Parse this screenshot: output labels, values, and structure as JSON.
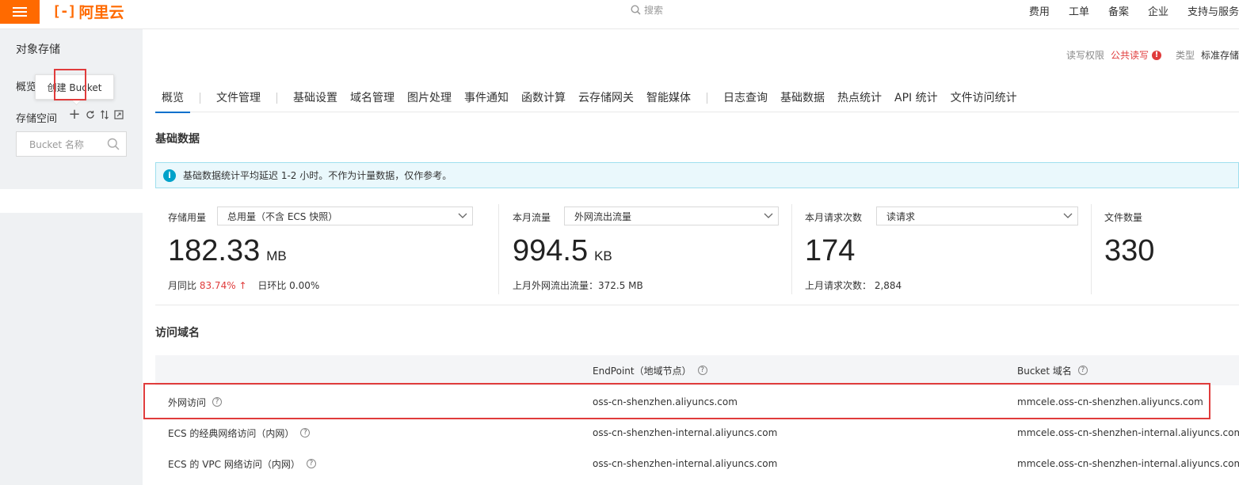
{
  "topbar": {
    "logo_text": "阿里云",
    "search_placeholder": "搜索",
    "nav": [
      "费用",
      "工单",
      "备案",
      "企业",
      "支持与服务"
    ]
  },
  "sidebar": {
    "title": "对象存储",
    "overview": "概览",
    "storage_label": "存储空间",
    "tooltip": "创建 Bucket",
    "search_placeholder": "Bucket 名称"
  },
  "permissions": {
    "rw_label": "读写权限",
    "rw_value": "公共读写",
    "type_label": "类型",
    "type_value": "标准存储"
  },
  "tabs": [
    {
      "label": "概览",
      "active": true
    },
    {
      "label": "文件管理"
    },
    {
      "label": "基础设置"
    },
    {
      "label": "域名管理"
    },
    {
      "label": "图片处理"
    },
    {
      "label": "事件通知"
    },
    {
      "label": "函数计算"
    },
    {
      "label": "云存储网关"
    },
    {
      "label": "智能媒体"
    },
    {
      "label": "日志查询"
    },
    {
      "label": "基础数据"
    },
    {
      "label": "热点统计"
    },
    {
      "label": "API 统计"
    },
    {
      "label": "文件访问统计"
    }
  ],
  "basic_data": {
    "title": "基础数据",
    "notice": "基础数据统计平均延迟 1-2 小时。不作为计量数据，仅作参考。",
    "storage": {
      "label": "存储用量",
      "select": "总用量（不含 ECS 快照）",
      "value": "182.33",
      "unit": "MB",
      "mom_label": "月同比",
      "mom_value": "83.74%",
      "mom_arrow": "↑",
      "dod_label": "日环比",
      "dod_value": "0.00%"
    },
    "traffic": {
      "label": "本月流量",
      "select": "外网流出流量",
      "value": "994.5",
      "unit": "KB",
      "sub": "上月外网流出流量：372.5 MB"
    },
    "requests": {
      "label": "本月请求次数",
      "select": "读请求",
      "value": "174",
      "sub": "上月请求次数：  2,884"
    },
    "files": {
      "label": "文件数量",
      "value": "330"
    }
  },
  "domains": {
    "title": "访问域名",
    "col_endpoint": "EndPoint（地域节点）",
    "col_bucket": "Bucket 域名",
    "rows": [
      {
        "name": "外网访问",
        "endpoint": "oss-cn-shenzhen.aliyuncs.com",
        "bucket": "mmcele.oss-cn-shenzhen.aliyuncs.com"
      },
      {
        "name": "ECS 的经典网络访问（内网）",
        "endpoint": "oss-cn-shenzhen-internal.aliyuncs.com",
        "bucket": "mmcele.oss-cn-shenzhen-internal.aliyuncs.com"
      },
      {
        "name": "ECS 的 VPC 网络访问（内网）",
        "endpoint": "oss-cn-shenzhen-internal.aliyuncs.com",
        "bucket": "mmcele.oss-cn-shenzhen-internal.aliyuncs.com"
      }
    ]
  },
  "colors": {
    "brand": "#ff6a00",
    "accent": "#0070cc",
    "danger": "#e03c3c",
    "info": "#00a2ca"
  }
}
